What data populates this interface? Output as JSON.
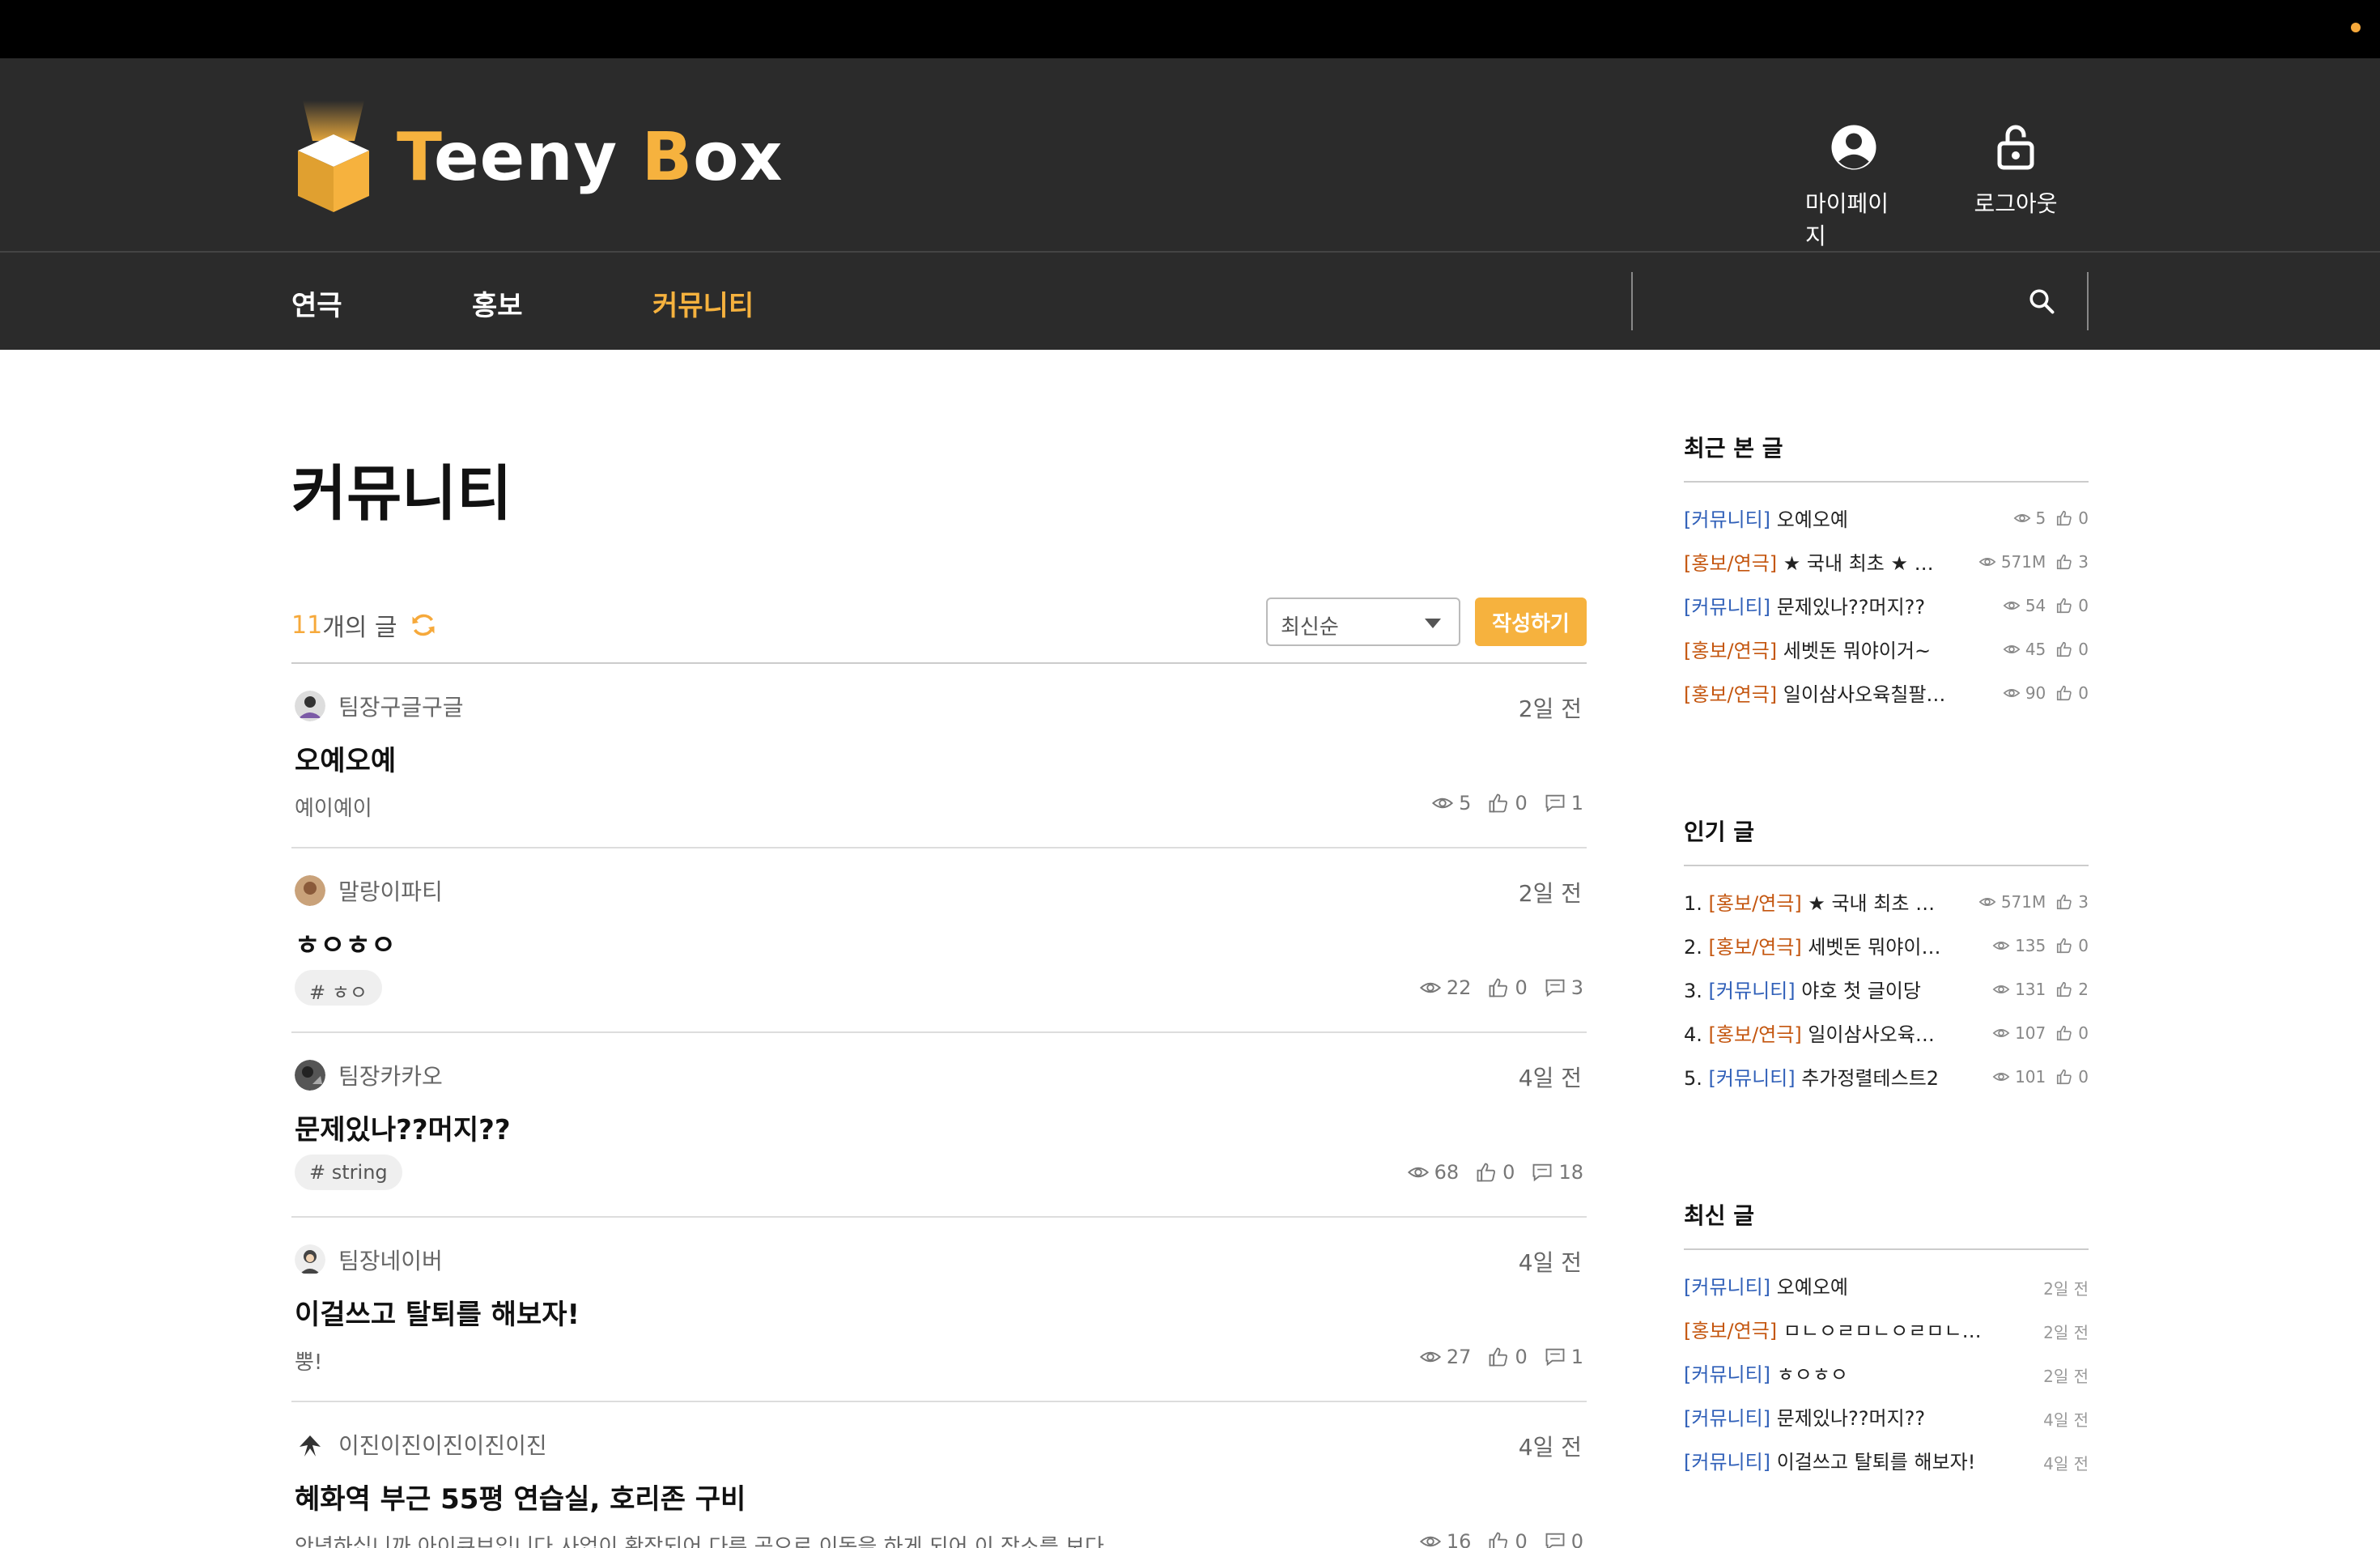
{
  "header": {
    "logo_prefix": "T",
    "logo_mid": "eeny ",
    "logo_b": "B",
    "logo_suffix": "ox",
    "mypage_label": "마이페이지",
    "logout_label": "로그아웃"
  },
  "nav": {
    "items": [
      {
        "label": "연극"
      },
      {
        "label": "홍보"
      },
      {
        "label": "커뮤니티"
      }
    ],
    "search_placeholder": ""
  },
  "main": {
    "title": "커뮤니티",
    "count_num": "11",
    "count_suffix": "개의 글",
    "sort_selected": "최신순",
    "write_label": "작성하기",
    "posts": [
      {
        "author": "팀장구글구글",
        "date": "2일 전",
        "title": "오예오예",
        "body": "예이예이",
        "tag": "",
        "views": "5",
        "likes": "0",
        "comments": "1"
      },
      {
        "author": "말랑이파티",
        "date": "2일 전",
        "title": "ㅎㅇㅎㅇ",
        "body": "",
        "tag": "# ㅎㅇ",
        "views": "22",
        "likes": "0",
        "comments": "3"
      },
      {
        "author": "팀장카카오",
        "date": "4일 전",
        "title": "문제있나??머지??",
        "body": "",
        "tag": "# string",
        "views": "68",
        "likes": "0",
        "comments": "18"
      },
      {
        "author": "팀장네이버",
        "date": "4일 전",
        "title": "이걸쓰고 탈퇴를 해보자!",
        "body": "뿡!",
        "tag": "",
        "views": "27",
        "likes": "0",
        "comments": "1"
      },
      {
        "author": "이진이진이진이진이진",
        "date": "4일 전",
        "title": "혜화역 부근 55평 연습실, 호리존 구비",
        "body": "안녕하십니까 아이큐브입니다 사업이 확장되어 다른 곳으로 이동을 하게 되어 이 장소를 보다…",
        "tag": "",
        "views": "16",
        "likes": "0",
        "comments": "0"
      }
    ]
  },
  "sidebar": {
    "recent_title": "최근 본 글",
    "recent": [
      {
        "cat": "[커뮤니티]",
        "type": "comm",
        "text": "오예오예",
        "views": "5",
        "likes": "0"
      },
      {
        "cat": "[홍보/연극]",
        "type": "promo",
        "text": "★ 국내 최초 ★ 성인…",
        "views": "571M",
        "likes": "3"
      },
      {
        "cat": "[커뮤니티]",
        "type": "comm",
        "text": "문제있나??머지??",
        "views": "54",
        "likes": "0"
      },
      {
        "cat": "[홍보/연극]",
        "type": "promo",
        "text": "세벳돈 뭐야이거~",
        "views": "45",
        "likes": "0"
      },
      {
        "cat": "[홍보/연극]",
        "type": "promo",
        "text": "일이삼사오육칠팔구십…",
        "views": "90",
        "likes": "0"
      }
    ],
    "popular_title": "인기 글",
    "popular": [
      {
        "rank": "1.",
        "cat": "[홍보/연극]",
        "type": "promo",
        "text": "★ 국내 최초 ★ …",
        "views": "571M",
        "likes": "3"
      },
      {
        "rank": "2.",
        "cat": "[홍보/연극]",
        "type": "promo",
        "text": "세벳돈 뭐야이거~",
        "views": "135",
        "likes": "0"
      },
      {
        "rank": "3.",
        "cat": "[커뮤니티]",
        "type": "comm",
        "text": "야호 첫 글이당",
        "views": "131",
        "likes": "2"
      },
      {
        "rank": "4.",
        "cat": "[홍보/연극]",
        "type": "promo",
        "text": "일이삼사오육칠팔…",
        "views": "107",
        "likes": "0"
      },
      {
        "rank": "5.",
        "cat": "[커뮤니티]",
        "type": "comm",
        "text": "추가정렬테스트2",
        "views": "101",
        "likes": "0"
      }
    ],
    "latest_title": "최신 글",
    "latest": [
      {
        "cat": "[커뮤니티]",
        "type": "comm",
        "text": "오예오예",
        "date": "2일 전"
      },
      {
        "cat": "[홍보/연극]",
        "type": "promo",
        "text": "ㅁㄴㅇㄹㅁㄴㅇㄹㅁㄴㅇㄹ",
        "date": "2일 전"
      },
      {
        "cat": "[커뮤니티]",
        "type": "comm",
        "text": "ㅎㅇㅎㅇ",
        "date": "2일 전"
      },
      {
        "cat": "[커뮤니티]",
        "type": "comm",
        "text": "문제있나??머지??",
        "date": "4일 전"
      },
      {
        "cat": "[커뮤니티]",
        "type": "comm",
        "text": "이걸쓰고 탈퇴를 해보자!",
        "date": "4일 전"
      }
    ]
  },
  "colors": {
    "accent": "#f6b23e",
    "header_bg": "#2b2b2b",
    "community_cat": "#2f5fb8",
    "promo_cat": "#c4560f"
  }
}
